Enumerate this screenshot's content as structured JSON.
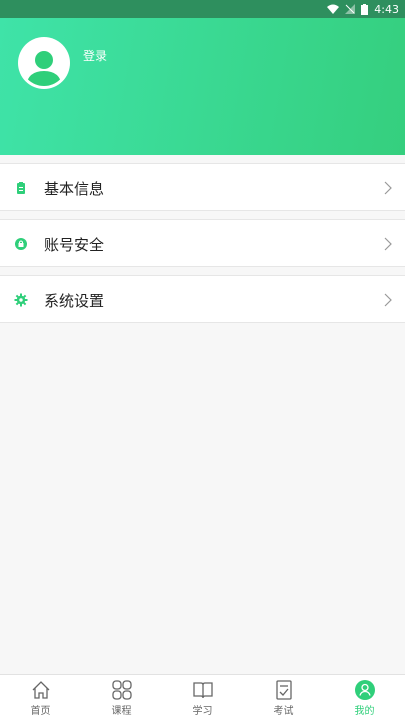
{
  "status_bar": {
    "time": "4:43"
  },
  "header": {
    "login_label": "登录"
  },
  "menu": [
    {
      "label": "基本信息",
      "icon": "clipboard-icon"
    },
    {
      "label": "账号安全",
      "icon": "lock-icon"
    },
    {
      "label": "系统设置",
      "icon": "gear-icon"
    }
  ],
  "tabs": [
    {
      "label": "首页",
      "icon": "home-icon"
    },
    {
      "label": "课程",
      "icon": "grid-icon"
    },
    {
      "label": "学习",
      "icon": "book-icon"
    },
    {
      "label": "考试",
      "icon": "exam-icon"
    },
    {
      "label": "我的",
      "icon": "profile-icon",
      "active": true
    }
  ],
  "colors": {
    "accent": "#2fcf7a",
    "header_start": "#3fe3a8",
    "header_end": "#35cf7e"
  }
}
